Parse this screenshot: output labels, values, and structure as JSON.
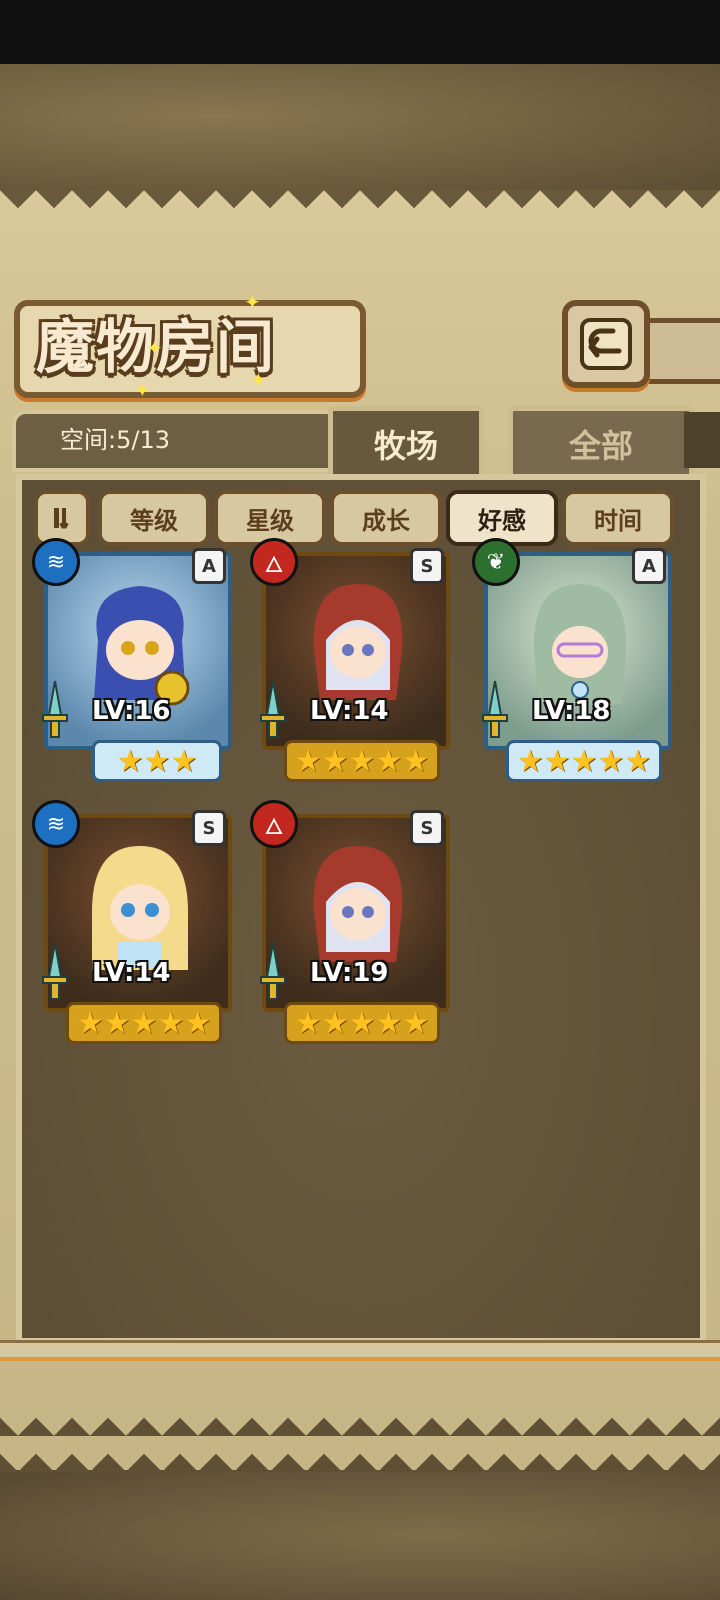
{
  "header": {
    "title": "魔物房间",
    "back_icon": "return-arrow-icon"
  },
  "capacity": {
    "label": "空间:5/13"
  },
  "tabs": [
    {
      "label": "牧场",
      "active": true
    },
    {
      "label": "全部",
      "active": false
    }
  ],
  "sort": {
    "toggle_icon": "sort-order-icon",
    "options": [
      {
        "label": "等级",
        "selected": false
      },
      {
        "label": "星级",
        "selected": false
      },
      {
        "label": "成长",
        "selected": false
      },
      {
        "label": "好感",
        "selected": true
      },
      {
        "label": "时间",
        "selected": false
      }
    ]
  },
  "monsters": [
    {
      "element": "water",
      "element_icon": "water-element-icon",
      "rank": "A",
      "level": "LV:16",
      "stars": "★★★",
      "star_count": 3,
      "frame": "blue"
    },
    {
      "element": "fire",
      "element_icon": "fire-element-icon",
      "rank": "S",
      "level": "LV:14",
      "stars": "★★★★★",
      "star_count": 5,
      "frame": "gold"
    },
    {
      "element": "wood",
      "element_icon": "wood-element-icon",
      "rank": "A",
      "level": "LV:18",
      "stars": "★★★★★",
      "star_count": 5,
      "frame": "blue"
    },
    {
      "element": "water",
      "element_icon": "water-element-icon",
      "rank": "S",
      "level": "LV:14",
      "stars": "★★★★★",
      "star_count": 5,
      "frame": "gold"
    },
    {
      "element": "fire",
      "element_icon": "fire-element-icon",
      "rank": "S",
      "level": "LV:19",
      "stars": "★★★★★",
      "star_count": 5,
      "frame": "gold"
    }
  ],
  "colors": {
    "accent_orange": "#e0963d",
    "gold_frame": "#f2d23a",
    "blue_frame": "#6cb4da",
    "water": "#1d6fc0",
    "fire": "#c3281f",
    "wood": "#2c6f2e"
  }
}
